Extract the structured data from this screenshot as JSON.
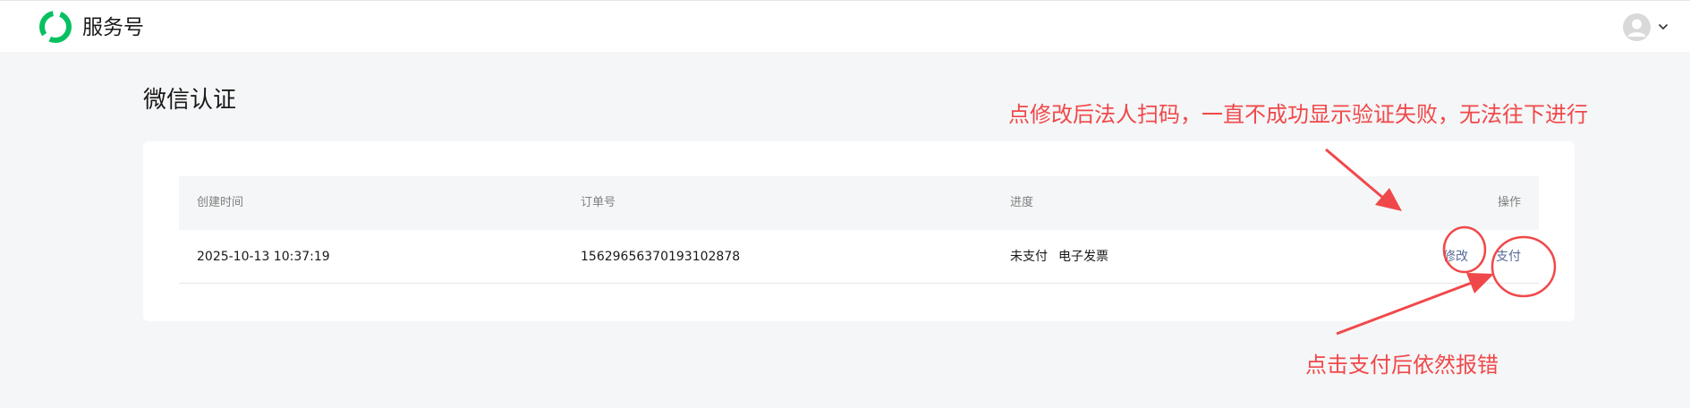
{
  "header": {
    "brand": "服务号",
    "logo_icon": "wechat-service-logo-icon",
    "avatar_icon": "user-avatar-icon",
    "menu_icon": "chevron-down-icon"
  },
  "page": {
    "title": "微信认证"
  },
  "table": {
    "headers": [
      "创建时间",
      "订单号",
      "进度",
      "操作"
    ],
    "rows": [
      {
        "created_at": "2025-10-13 10:37:19",
        "order_no": "15629656370193102878",
        "status": "未支付",
        "invoice": "电子发票",
        "actions": [
          "修改",
          "支付"
        ]
      }
    ]
  },
  "annotations": {
    "top_note": "点修改后法人扫码，一直不成功显示验证失败，无法往下进行",
    "bottom_note": "点击支付后依然报错",
    "color": "#f0484a"
  },
  "colors": {
    "brand_green": "#07c160",
    "link": "#576b95",
    "annotation_red": "#f0484a"
  }
}
